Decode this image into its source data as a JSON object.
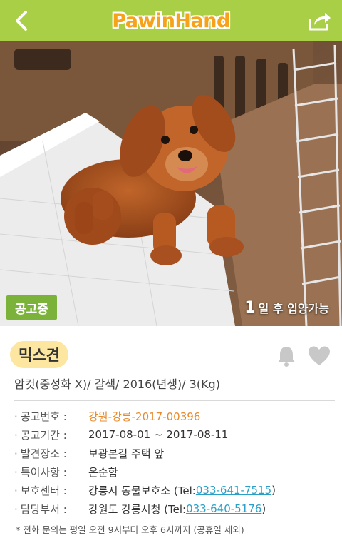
{
  "header": {
    "logo_text": "PawinHand",
    "brand_color": "#a8cf45",
    "logo_color": "#f6a21a",
    "back_icon": "chevron-left-icon",
    "share_icon": "share-icon"
  },
  "photo": {
    "status_badge": "공고중",
    "adopt_days": "1",
    "adopt_suffix": "일 후 입양가능"
  },
  "pet": {
    "breed": "믹스견",
    "summary": "암컷(중성화 X)/ 갈색/ 2016(년생)/ 3(Kg)",
    "actions": [
      "bell-icon",
      "heart-icon"
    ]
  },
  "details": {
    "notice_no": {
      "label": "공고번호 :",
      "value": "강원-강릉-2017-00396"
    },
    "period": {
      "label": "공고기간 :",
      "value": "2017-08-01 ~ 2017-08-11"
    },
    "found_place": {
      "label": "발견장소 :",
      "value": "보광본길 주택 앞"
    },
    "note": {
      "label": "특이사항 :",
      "value": "온순함"
    },
    "center": {
      "label": "보호센터 :",
      "value": "강릉시 동물보호소 (Tel: ",
      "phone": "033-641-7515",
      "close": ")"
    },
    "department": {
      "label": "담당부서 :",
      "value": "강원도 강릉시청 (Tel: ",
      "phone": "033-640-5176",
      "close": ")"
    }
  },
  "footnote": "* 전화 문의는 평일 오전 9시부터 오후 6시까지 (공휴일 제외)"
}
